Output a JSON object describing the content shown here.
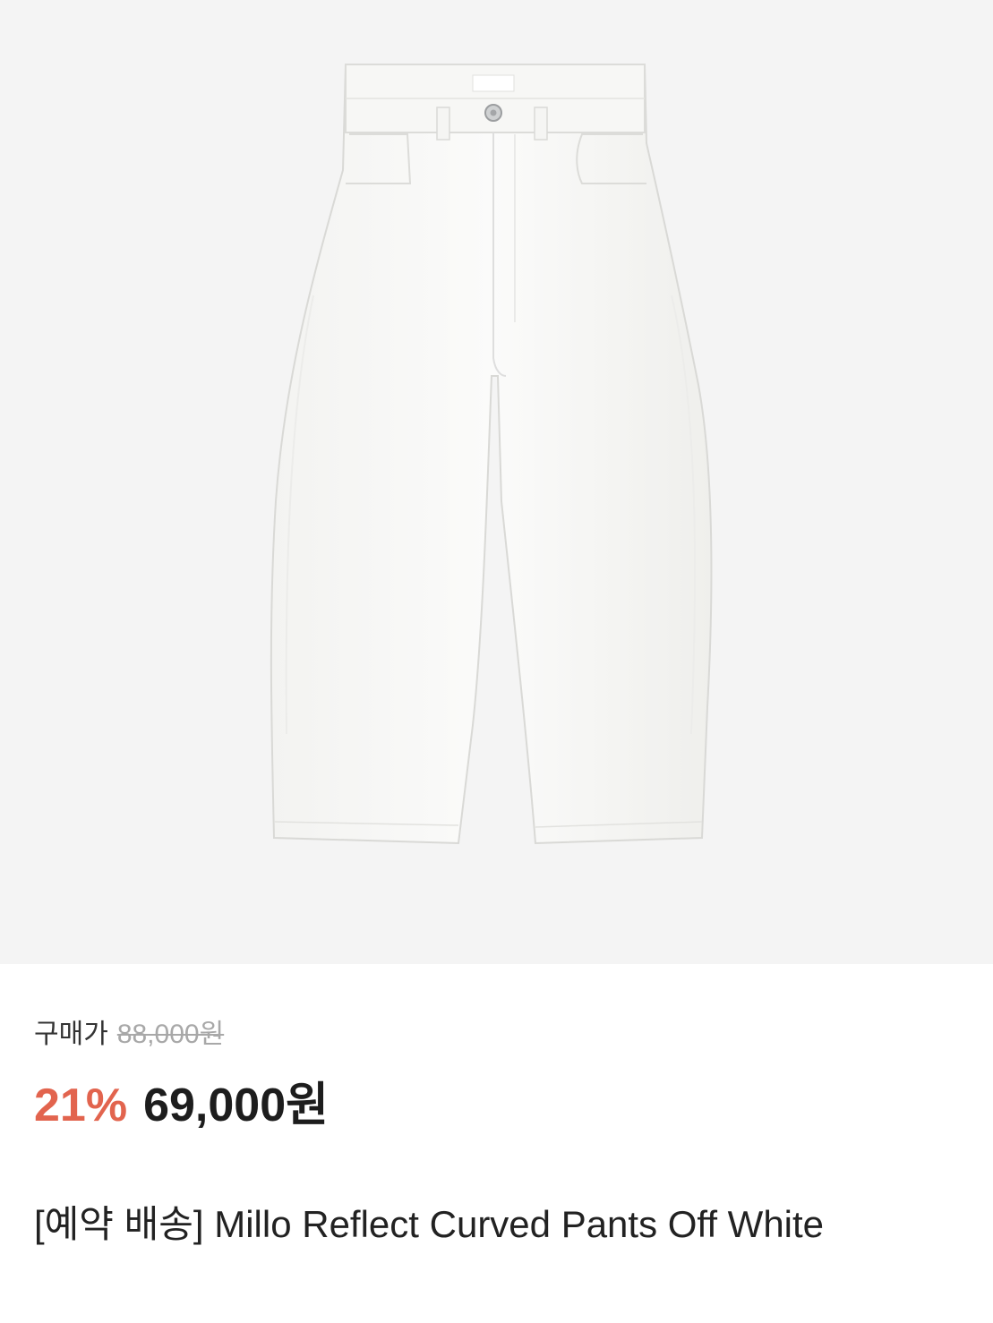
{
  "product": {
    "image_alt": "off-white curved pants",
    "price_label": "구매가",
    "original_price": "88,000원",
    "discount_rate": "21%",
    "sale_price": "69,000원",
    "title": "[예약 배송] Millo Reflect Curved Pants Off White"
  },
  "colors": {
    "image_background": "#f4f4f4",
    "discount": "#e2644e",
    "price": "#1d1d1d",
    "original_price": "#a8a8a8"
  }
}
